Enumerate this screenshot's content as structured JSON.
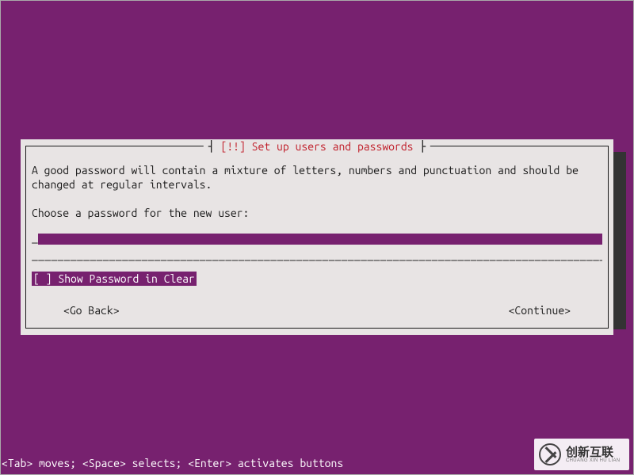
{
  "dialog": {
    "title_prefix": "[!!] ",
    "title": "Set up users and passwords",
    "body": "A good password will contain a mixture of letters, numbers and punctuation and should be\nchanged at regular intervals.",
    "prompt": "Choose a password for the new user:",
    "input_value": "",
    "checkbox": {
      "checked": false,
      "label": "Show Password in Clear",
      "render": "[ ] Show Password in Clear"
    },
    "go_back": "<Go Back>",
    "continue": "<Continue>"
  },
  "footer_hint": "<Tab> moves; <Space> selects; <Enter> activates buttons",
  "underscore_row": "_________________________________________________________________________________________",
  "watermark": {
    "cn": "创新互联",
    "en": "CHUANG XIN HU LIAN"
  }
}
